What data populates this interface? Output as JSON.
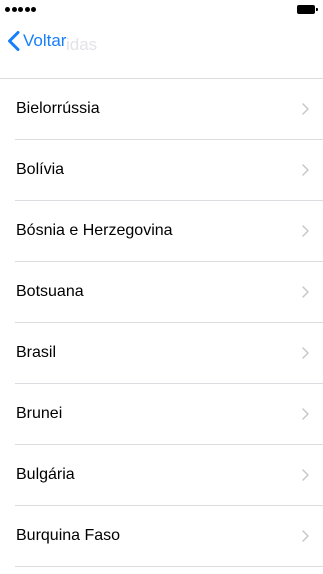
{
  "nav": {
    "back_label": "Voltar",
    "ghost_title": "idas"
  },
  "icons": {
    "back": "chevron-left-icon",
    "disclosure": "chevron-right-icon",
    "signal": "signal-dots-icon",
    "battery": "battery-icon"
  },
  "colors": {
    "accent": "#157efb",
    "separator": "#dcdce0",
    "disclosure": "#c7c7cc"
  },
  "countries": [
    {
      "label": "Bielorrússia"
    },
    {
      "label": "Bolívia"
    },
    {
      "label": "Bósnia e Herzegovina"
    },
    {
      "label": "Botsuana"
    },
    {
      "label": "Brasil"
    },
    {
      "label": "Brunei"
    },
    {
      "label": "Bulgária"
    },
    {
      "label": "Burquina Faso"
    }
  ]
}
